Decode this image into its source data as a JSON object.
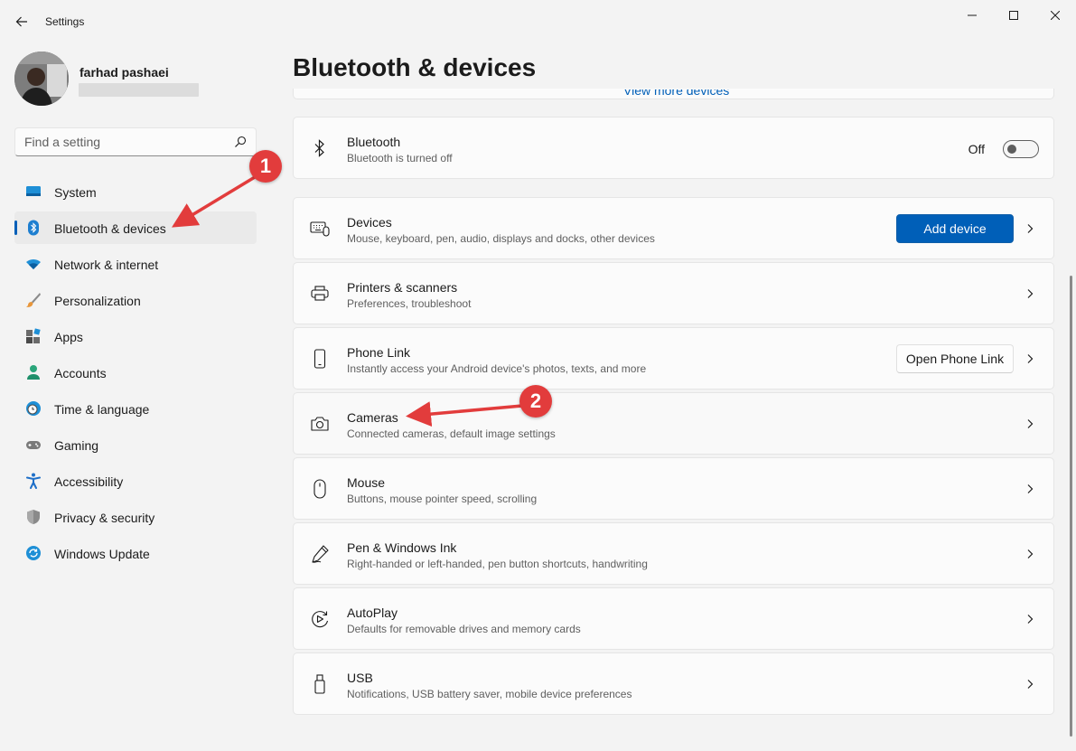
{
  "window": {
    "title": "Settings"
  },
  "user": {
    "name": "farhad pashaei"
  },
  "search": {
    "placeholder": "Find a setting"
  },
  "sidebar": {
    "items": [
      {
        "label": "System",
        "icon": "monitor-icon"
      },
      {
        "label": "Bluetooth & devices",
        "icon": "bluetooth-icon",
        "active": true
      },
      {
        "label": "Network & internet",
        "icon": "wifi-icon"
      },
      {
        "label": "Personalization",
        "icon": "brush-icon"
      },
      {
        "label": "Apps",
        "icon": "apps-icon"
      },
      {
        "label": "Accounts",
        "icon": "person-icon"
      },
      {
        "label": "Time & language",
        "icon": "globe-clock-icon"
      },
      {
        "label": "Gaming",
        "icon": "gamepad-icon"
      },
      {
        "label": "Accessibility",
        "icon": "accessibility-icon"
      },
      {
        "label": "Privacy & security",
        "icon": "shield-icon"
      },
      {
        "label": "Windows Update",
        "icon": "update-icon"
      }
    ]
  },
  "main": {
    "title": "Bluetooth & devices",
    "partial_link": "View more devices",
    "bluetooth": {
      "title": "Bluetooth",
      "subtitle": "Bluetooth is turned off",
      "toggle_label": "Off",
      "toggle_on": false
    },
    "cards": [
      {
        "title": "Devices",
        "subtitle": "Mouse, keyboard, pen, audio, displays and docks, other devices",
        "button": "Add device",
        "icon": "keyboard-icon"
      },
      {
        "title": "Printers & scanners",
        "subtitle": "Preferences, troubleshoot",
        "icon": "printer-icon"
      },
      {
        "title": "Phone Link",
        "subtitle": "Instantly access your Android device's photos, texts, and more",
        "button": "Open Phone Link",
        "icon": "phone-icon"
      },
      {
        "title": "Cameras",
        "subtitle": "Connected cameras, default image settings",
        "icon": "camera-icon"
      },
      {
        "title": "Mouse",
        "subtitle": "Buttons, mouse pointer speed, scrolling",
        "icon": "mouse-icon"
      },
      {
        "title": "Pen & Windows Ink",
        "subtitle": "Right-handed or left-handed, pen button shortcuts, handwriting",
        "icon": "pen-icon"
      },
      {
        "title": "AutoPlay",
        "subtitle": "Defaults for removable drives and memory cards",
        "icon": "autoplay-icon"
      },
      {
        "title": "USB",
        "subtitle": "Notifications, USB battery saver, mobile device preferences",
        "icon": "usb-icon"
      }
    ]
  },
  "annotations": {
    "badge_1": "1",
    "badge_2": "2",
    "color": "#e23c3c"
  },
  "colors": {
    "accent": "#005fb8",
    "background": "#f3f3f3",
    "card": "#fbfbfb"
  }
}
